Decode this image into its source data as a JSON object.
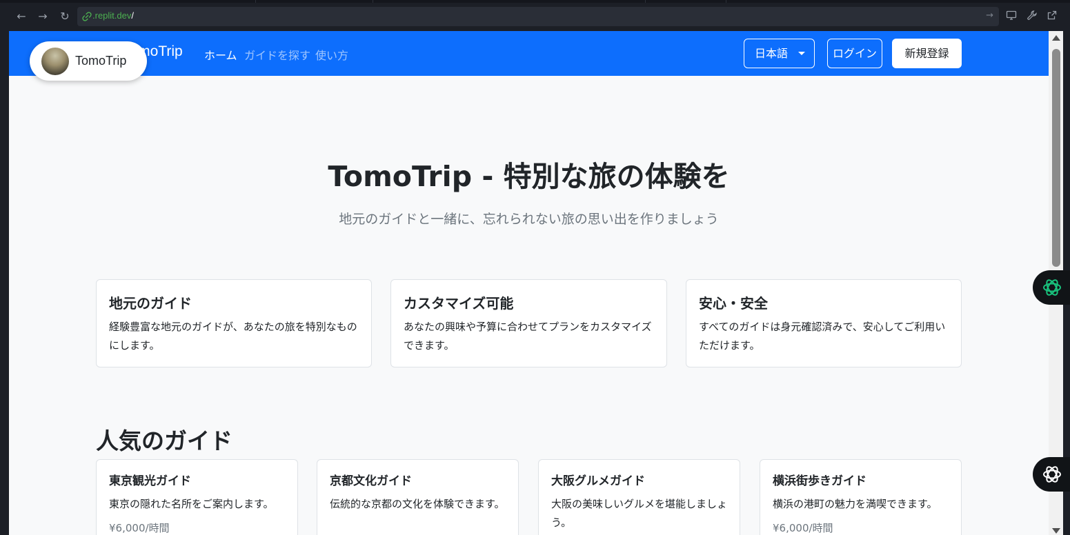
{
  "browser": {
    "url_host": ".replit.dev",
    "url_path": "/"
  },
  "navbar": {
    "brand": "TomoTrip",
    "links": [
      {
        "label": "ホーム",
        "active": true
      },
      {
        "label": "ガイドを探す",
        "active": false
      },
      {
        "label": "使い方",
        "active": false
      }
    ],
    "language": "日本語",
    "login": "ログイン",
    "signup": "新規登録",
    "color": "#0d6efd"
  },
  "overlay_badge": {
    "label": "TomoTrip"
  },
  "hero": {
    "title": "TomoTrip - 特別な旅の体験を",
    "subtitle": "地元のガイドと一緒に、忘れられない旅の思い出を作りましょう"
  },
  "features": [
    {
      "title": "地元のガイド",
      "text": "経験豊富な地元のガイドが、あなたの旅を特別なものにします。"
    },
    {
      "title": "カスタマイズ可能",
      "text": "あなたの興味や予算に合わせてプランをカスタマイズできます。"
    },
    {
      "title": "安心・安全",
      "text": "すべてのガイドは身元確認済みで、安心してご利用いただけます。"
    }
  ],
  "popular": {
    "title": "人気のガイド",
    "guides": [
      {
        "title": "東京観光ガイド",
        "text": "東京の隠れた名所をご案内します。",
        "price": "¥6,000/時間"
      },
      {
        "title": "京都文化ガイド",
        "text": "伝統的な京都の文化を体験できます。",
        "price": ""
      },
      {
        "title": "大阪グルメガイド",
        "text": "大阪の美味しいグルメを堪能しましょう。",
        "price": ""
      },
      {
        "title": "横浜街歩きガイド",
        "text": "横浜の港町の魅力を満喫できます。",
        "price": "¥6,000/時間"
      }
    ]
  }
}
